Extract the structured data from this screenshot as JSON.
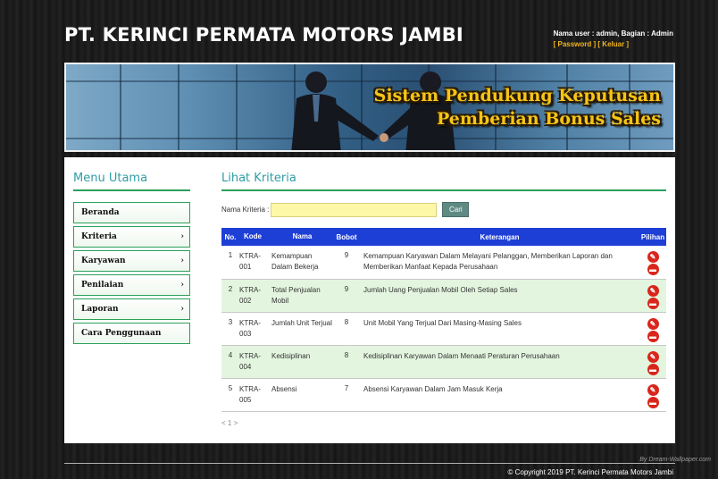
{
  "header": {
    "title": "PT. KERINCI PERMATA MOTORS JAMBI",
    "user_info": "Nama user : admin, Bagian : Admin",
    "password_link": "[ Password ]",
    "logout_link": "[ Keluar ]"
  },
  "banner": {
    "line1": "Sistem Pendukung Keputusan",
    "line2": "Pemberian Bonus Sales"
  },
  "sidebar": {
    "title": "Menu Utama",
    "items": [
      {
        "label": "Beranda",
        "arrow": ""
      },
      {
        "label": "Kriteria",
        "arrow": "›"
      },
      {
        "label": "Karyawan",
        "arrow": "›"
      },
      {
        "label": "Penilaian",
        "arrow": "›"
      },
      {
        "label": "Laporan",
        "arrow": "›"
      },
      {
        "label": "Cara Penggunaan",
        "arrow": ""
      }
    ]
  },
  "main": {
    "title": "Lihat Kriteria",
    "search_label": "Nama Kriteria :",
    "search_value": "",
    "search_button": "Cari",
    "columns": [
      "No.",
      "Kode",
      "Nama",
      "Bobot",
      "Keterangan",
      "Pilihan"
    ],
    "rows": [
      {
        "no": "1",
        "kode": "KTRA-001",
        "nama": "Kemampuan Dalam Bekerja",
        "bobot": "9",
        "keterangan": "Kemampuan Karyawan Dalam Melayani Pelanggan, Memberikan Laporan dan Memberikan Manfaat Kepada Perusahaan"
      },
      {
        "no": "2",
        "kode": "KTRA-002",
        "nama": "Total Penjualan Mobil",
        "bobot": "9",
        "keterangan": "Jumlah Uang Penjualan Mobil Oleh Setiap Sales"
      },
      {
        "no": "3",
        "kode": "KTRA-003",
        "nama": "Jumlah Unit Terjual",
        "bobot": "8",
        "keterangan": "Unit Mobil Yang Terjual Dari Masing-Masing Sales"
      },
      {
        "no": "4",
        "kode": "KTRA-004",
        "nama": "Kedisiplinan",
        "bobot": "8",
        "keterangan": "Kedisiplinan Karyawan Dalam Menaati Peraturan Perusahaan"
      },
      {
        "no": "5",
        "kode": "KTRA-005",
        "nama": "Absensi",
        "bobot": "7",
        "keterangan": "Absensi Karyawan Dalam Jam Masuk Kerja"
      }
    ],
    "pagination": "< 1 >"
  },
  "footer": {
    "watermark": "By Dream-Wallpaper.com",
    "copyright": "© Copyright 2019 PT. Kerinci Permata Motors Jambi"
  },
  "colors": {
    "accent_green": "#2aa05a",
    "heading_teal": "#2e9ea5",
    "table_header": "#1e3fd6",
    "action_red": "#d9261c",
    "banner_text": "#f5c518"
  },
  "icons": {
    "edit": "edit-icon",
    "delete": "trash-icon",
    "menu_arrow": "chevron-right-icon"
  }
}
